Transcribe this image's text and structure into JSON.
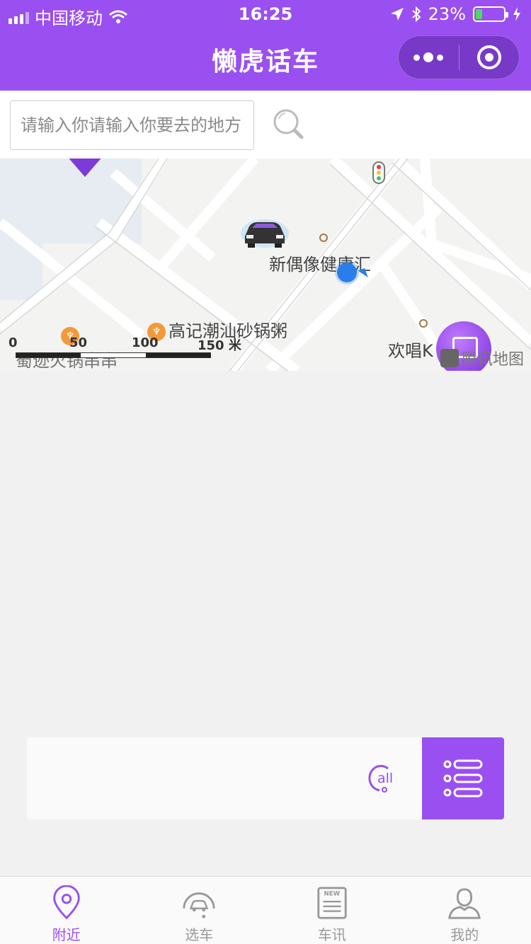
{
  "status": {
    "carrier": "中国移动",
    "time": "16:25",
    "battery": "23%",
    "battery_level": 0.23
  },
  "nav": {
    "title": "懒虎话车"
  },
  "search": {
    "placeholder": "请输入你请输入你要去的地方"
  },
  "map": {
    "pois": [
      "新偶像健康汇",
      "高记潮汕砂锅粥",
      "蜀迹火锅串串",
      "欢唱K"
    ],
    "scale_labels": [
      "0",
      "50",
      "100",
      "150 米"
    ],
    "watermark": "腾讯地图"
  },
  "tabs": [
    {
      "label": "附近",
      "icon": "location-pin-icon",
      "active": true
    },
    {
      "label": "选车",
      "icon": "car-icon",
      "active": false
    },
    {
      "label": "车讯",
      "icon": "news-icon",
      "active": false
    },
    {
      "label": "我的",
      "icon": "user-icon",
      "active": false
    }
  ],
  "colors": {
    "brand": "#9a4ff0",
    "tab_inactive": "#999999"
  }
}
